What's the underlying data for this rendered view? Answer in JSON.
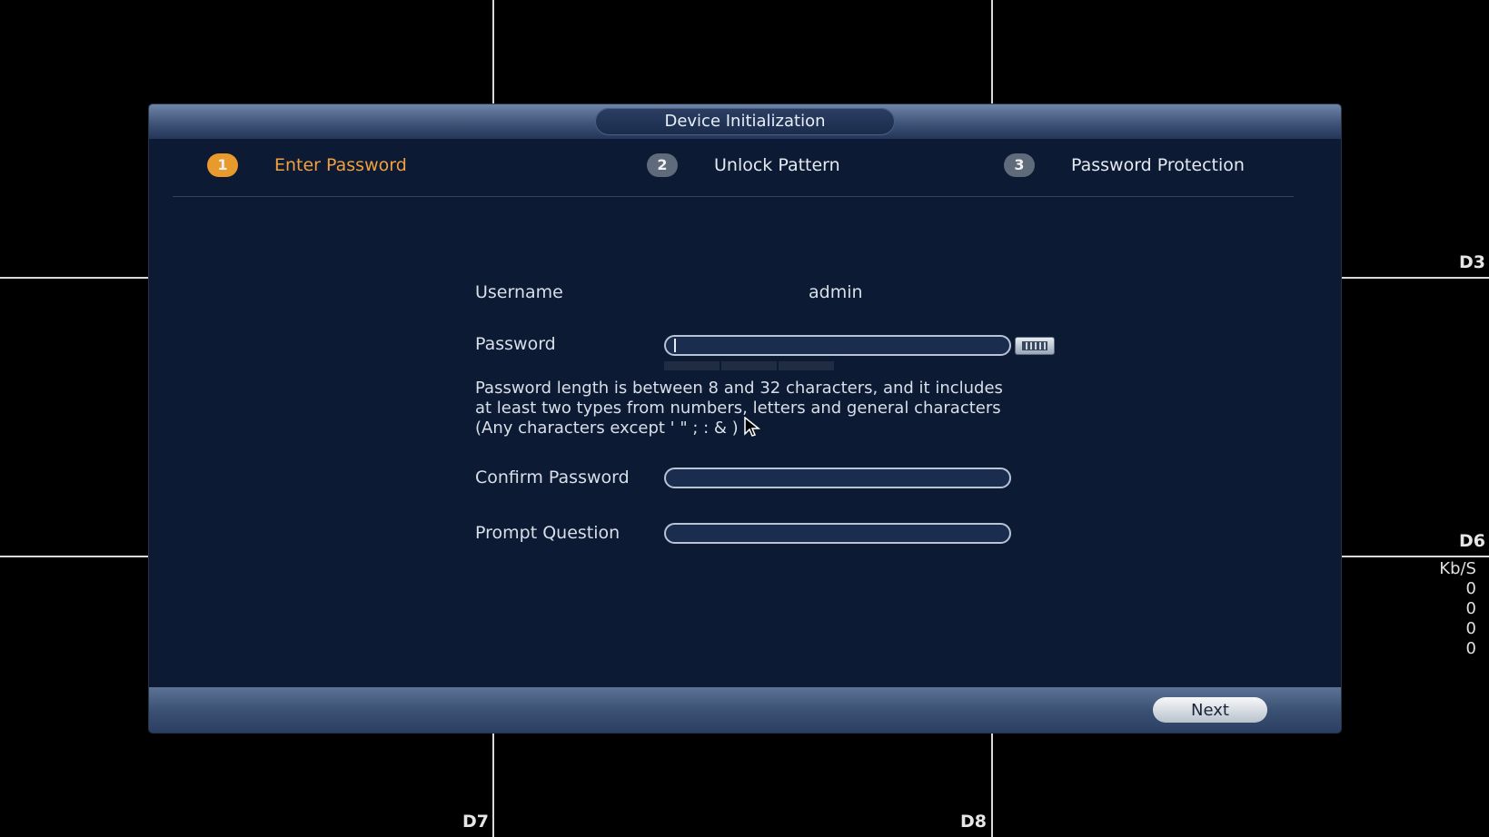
{
  "dialog": {
    "title": "Device Initialization",
    "steps": [
      {
        "number": "1",
        "label": "Enter Password",
        "active": true
      },
      {
        "number": "2",
        "label": "Unlock Pattern",
        "active": false
      },
      {
        "number": "3",
        "label": "Password Protection",
        "active": false
      }
    ],
    "form": {
      "username_label": "Username",
      "username_value": "admin",
      "password_label": "Password",
      "password_value": "",
      "hint": "Password length is between 8 and 32 characters, and it includes at least two types from numbers, letters and general characters (Any characters except  ' \" ; : & )",
      "confirm_label": "Confirm Password",
      "confirm_value": "",
      "question_label": "Prompt Question",
      "question_value": ""
    },
    "next_label": "Next"
  },
  "channels": {
    "d3": "D3",
    "d6": "D6",
    "d7": "D7",
    "d8": "D8"
  },
  "stats": {
    "unit": "Kb/S",
    "values": [
      "0",
      "0",
      "0",
      "0"
    ]
  },
  "colors": {
    "accent": "#e89a2d",
    "dialog_bg": "#0d1a33"
  }
}
